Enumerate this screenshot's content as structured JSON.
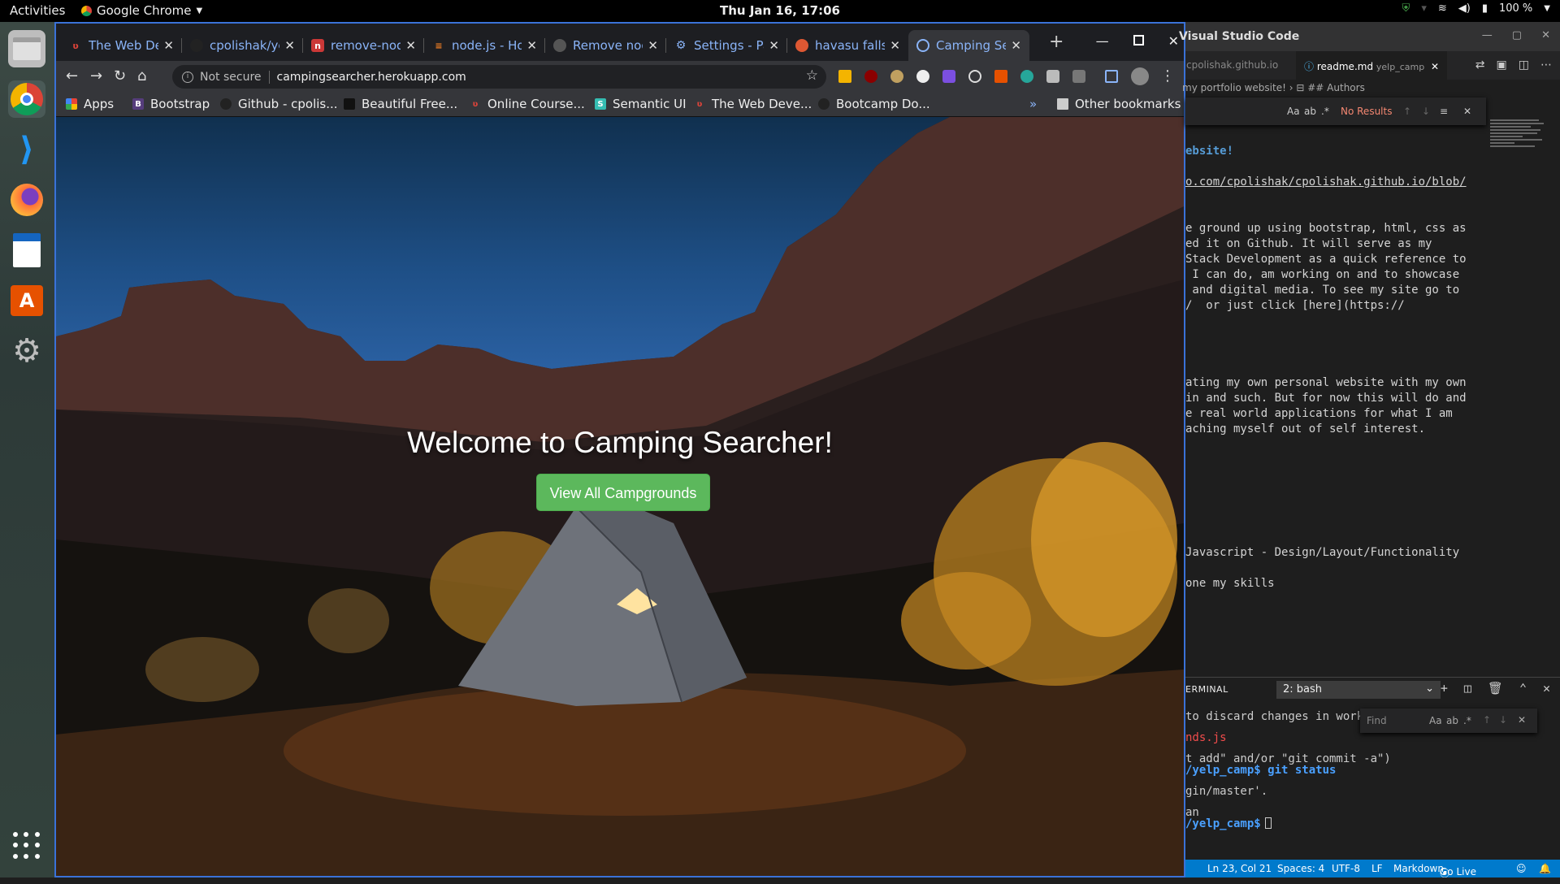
{
  "topbar": {
    "activities": "Activities",
    "app_name": "Google Chrome",
    "clock": "Thu Jan 16, 17:06",
    "battery": "100 %"
  },
  "dock": {
    "items": [
      "files-icon",
      "chrome-icon",
      "vscode-icon",
      "firefox-icon",
      "writer-icon",
      "software-icon",
      "settings-icon"
    ]
  },
  "chrome": {
    "tabs": [
      {
        "title": "The Web Dev",
        "favicon_color": "#e0443a"
      },
      {
        "title": "cpolishak/ye",
        "favicon_color": "#333333"
      },
      {
        "title": "remove-nod",
        "favicon_color": "#cb3837"
      },
      {
        "title": "node.js - Ho",
        "favicon_color": "#f48024"
      },
      {
        "title": "Remove nod",
        "favicon_color": "#333333"
      },
      {
        "title": "Settings - Pa",
        "favicon_color": "#8ab4f8"
      },
      {
        "title": "havasu falls",
        "favicon_color": "#de5833"
      },
      {
        "title": "Camping Se",
        "favicon_color": "#8ab4f8"
      }
    ],
    "new_tab": "+",
    "omnibox": {
      "security": "Not secure",
      "url": "campingsearcher.herokuapp.com"
    },
    "bookmarks": [
      {
        "label": "Apps"
      },
      {
        "label": "Bootstrap"
      },
      {
        "label": "Github - cpolis..."
      },
      {
        "label": "Beautiful Free..."
      },
      {
        "label": "Online Course..."
      },
      {
        "label": "Semantic UI"
      },
      {
        "label": "The Web Deve..."
      },
      {
        "label": "Bootcamp Do..."
      }
    ],
    "bookmarks_overflow": "»",
    "other_bookmarks": "Other bookmarks"
  },
  "page": {
    "heading": "Welcome to Camping Searcher!",
    "button_label": "View All Campgrounds",
    "button_color": "#5cb85c"
  },
  "vscode": {
    "title": "Visual Studio Code",
    "tab_inactive": "cpolishak.github.io",
    "tab_active": "readme.md",
    "tab_active_dir": "yelp_camp",
    "breadcrumb_1": "my portfolio website!",
    "breadcrumb_2": "## Authors",
    "find_results": "No Results",
    "code_lines": [
      "ebsite!",
      "o.com/cpolishak/cpolishak.github.io/blob/",
      "e ground up using bootstrap, html, css as",
      "ed it on Github. It will serve as my",
      "Stack Development as a quick reference to",
      " I can do, am working on and to showcase",
      " and digital media. To see my site go to",
      "/  or just click [here](https://",
      "ating my own personal website with my own",
      "in and such. But for now this will do and",
      "e real world applications for what I am",
      "aching myself out of self interest.",
      "Javascript - Design/Layout/Functionality",
      "one my skills"
    ],
    "panel_label": "ERMINAL",
    "terminal_select": "2: bash",
    "terminal_find_placeholder": "Find",
    "terminal_lines": [
      "to discard changes in work",
      "nds.js",
      "t add\" and/or \"git commit -a\")",
      "/yelp_camp$ git status",
      "gin/master'.",
      "an",
      "/yelp_camp$ "
    ],
    "status": {
      "position": "Ln 23, Col 21",
      "spaces": "Spaces: 4",
      "encoding": "UTF-8",
      "eol": "LF",
      "language": "Markdown",
      "golive": "Go Live"
    }
  }
}
